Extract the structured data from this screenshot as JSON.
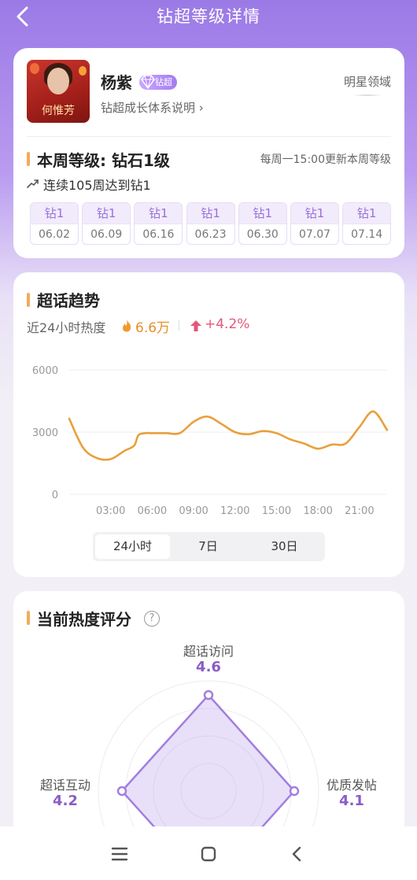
{
  "header": {
    "title": "钻超等级详情"
  },
  "profile": {
    "name": "杨紫",
    "badge": "钻超",
    "growth_link": "钻超成长体系说明 ›",
    "domain": "明星领域",
    "avatar_caption": "何惟芳"
  },
  "level": {
    "title": "本周等级: 钻石1级",
    "update_note": "每周一15:00更新本周等级",
    "streak": "连续105周达到钻1",
    "weeks": [
      {
        "level": "钻1",
        "date": "06.02"
      },
      {
        "level": "钻1",
        "date": "06.09"
      },
      {
        "level": "钻1",
        "date": "06.16"
      },
      {
        "level": "钻1",
        "date": "06.23"
      },
      {
        "level": "钻1",
        "date": "06.30"
      },
      {
        "level": "钻1",
        "date": "07.07"
      },
      {
        "level": "钻1",
        "date": "07.14"
      }
    ]
  },
  "trend": {
    "title": "超话趋势",
    "heat_label": "近24小时热度",
    "heat_value": "6.6万",
    "heat_change": "+4.2%",
    "tabs": [
      "24小时",
      "7日",
      "30日"
    ],
    "active_tab": "24小时"
  },
  "chart_data": {
    "type": "line",
    "x_ticks": [
      "03:00",
      "06:00",
      "09:00",
      "12:00",
      "15:00",
      "18:00",
      "21:00"
    ],
    "y_ticks": [
      "0",
      "3000",
      "6000"
    ],
    "ylim": [
      0,
      6000
    ],
    "xlim": [
      0,
      23
    ],
    "line_color": "#e8a03c",
    "x": [
      0,
      1,
      2,
      3,
      4,
      4.7,
      5,
      5.5,
      6,
      7,
      8,
      9,
      10,
      11,
      12,
      13,
      14,
      15,
      16,
      17,
      18,
      19,
      20,
      21,
      22,
      23
    ],
    "values": [
      3650,
      2250,
      1750,
      1700,
      2100,
      2350,
      2850,
      2950,
      2950,
      2950,
      2950,
      3500,
      3750,
      3400,
      3000,
      2900,
      3050,
      2950,
      2650,
      2450,
      2200,
      2400,
      2450,
      3250,
      4000,
      3100
    ]
  },
  "score": {
    "title": "当前热度评分",
    "help": "?",
    "axes": [
      {
        "label": "超话访问",
        "value": "4.6"
      },
      {
        "label": "优质发帖",
        "value": "4.1"
      },
      {
        "label": "超话互动",
        "value": "4.2"
      }
    ]
  }
}
